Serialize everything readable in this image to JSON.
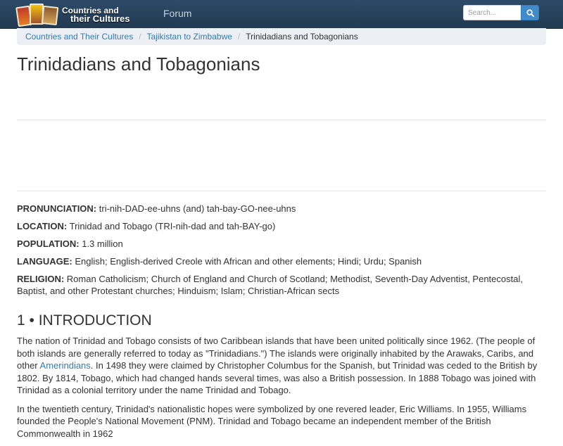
{
  "header": {
    "logo": {
      "line1": "Countries and",
      "line2": "their Cultures"
    },
    "forum_label": "Forum",
    "search": {
      "placeholder": "Search..."
    }
  },
  "breadcrumb": {
    "items": [
      "Countries and Their Cultures",
      "Tajikistan to Zimbabwe"
    ],
    "current": "Trinidadians and Tobagonians"
  },
  "page": {
    "title": "Trinidadians and Tobagonians",
    "facts": [
      {
        "label": "PRONUNCIATION:",
        "value": "tri-nih-DAD-ee-uhns (and) tah-bay-GO-nee-uhns"
      },
      {
        "label": "LOCATION:",
        "value": "Trinidad and Tobago (TRI-nih-dad and tah-BAY-go)"
      },
      {
        "label": "POPULATION:",
        "value": "1.3 million"
      },
      {
        "label": "LANGUAGE:",
        "value": "English; English-derived Creole with African and other elements; Hindi; Urdu; Spanish"
      },
      {
        "label": "RELIGION:",
        "value": "Roman Catholicism; Church of England and Church of Scotland; Methodist, Seventh-Day Adventist, Pentecostal, Baptist, and other Protestant churches; Hinduism; Islam; Christian-African sects"
      }
    ],
    "section_title": "1 • INTRODUCTION",
    "para1_before": "The nation of Trinidad and Tobago consists of two Caribbean islands that have been united politically since 1962. (The people of both islands are generally referred to today as \"Trinidadians.\") The islands were originally inhabited by the Arawaks, Caribs, and other ",
    "para1_link": "Amerindians",
    "para1_after": ". In 1498 they were claimed by Christopher Columbus for the Spanish, but Trinidad was ceded to the British by 1802. By 1814, Tobago, which had changed hands several times, was also a British possession. In 1888 Tobago was joined with Trinidad as a colonial territory under the name Trinidad and Tobago.",
    "para2": "In the twentieth century, Trinidad's nationalistic hopes were symbolized by one revered leader, Eric Williams. In 1955, Williams founded the People's National Movement (PNM). Trinidad and Tobago became an independent member of the British Commonwealth in 1962"
  }
}
